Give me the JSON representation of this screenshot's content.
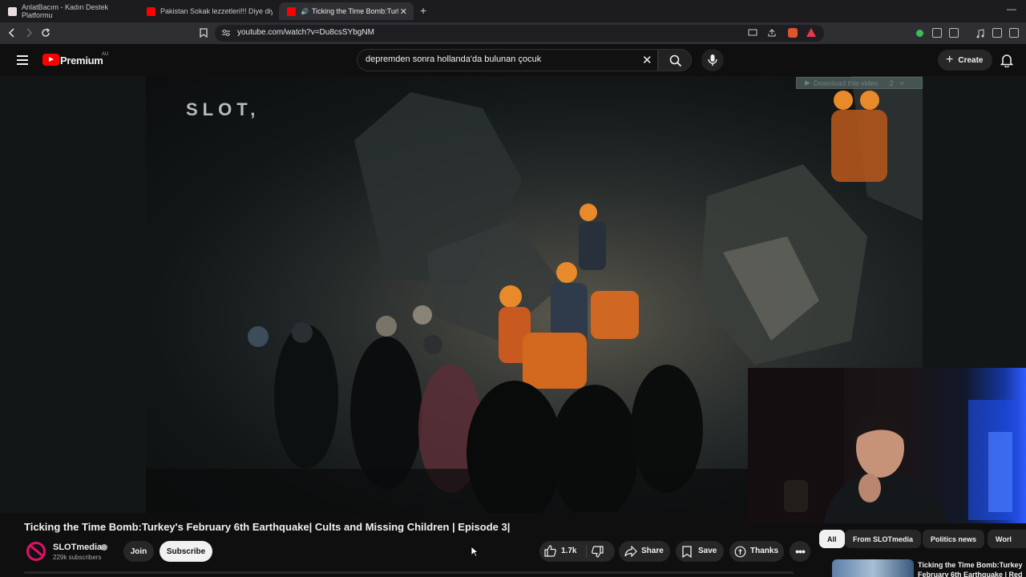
{
  "browser": {
    "tabs": [
      {
        "title": "AnlatBacım - Kadın Destek Platformu",
        "favicon_color": "#e8e0e0",
        "active": false
      },
      {
        "title": "Pakistan Sokak lezzetleri!!! Diye diye",
        "favicon_color": "#ff0000",
        "active": false
      },
      {
        "title": "Ticking the Time Bomb:Turke",
        "favicon_color": "#ff0000",
        "active": true
      }
    ],
    "new_tab_symbol": "+",
    "url": "youtube.com/watch?v=Du8csSYbgNM"
  },
  "youtube": {
    "brand": "Premium",
    "region": "AU",
    "search_query": "depremden sonra hollanda'da bulunan çocuk",
    "create_label": "Create"
  },
  "player": {
    "watermark": "SLOT,",
    "download_banner": "Download this video",
    "download_counter": "2",
    "download_close": "×"
  },
  "video": {
    "title": "Ticking the Time Bomb:Turkey's February 6th Earthquake| Cults and Missing Children | Episode 3|",
    "channel": "SLOTmedia",
    "subscribers": "229k subscribers",
    "join_label": "Join",
    "subscribe_label": "Subscribe",
    "likes": "1.7k",
    "share_label": "Share",
    "save_label": "Save",
    "thanks_label": "Thanks"
  },
  "rail": {
    "chips": [
      "All",
      "From SLOTmedia",
      "Politics news",
      "Worl"
    ],
    "recommended_title_line1": "Ticking the Time Bomb:Turkey",
    "recommended_title_line2": "February 6th Earthquake | Red"
  },
  "colors": {
    "accent": "#ff0000",
    "background": "#0f0f0f",
    "brand_pink": "#e0116b"
  }
}
